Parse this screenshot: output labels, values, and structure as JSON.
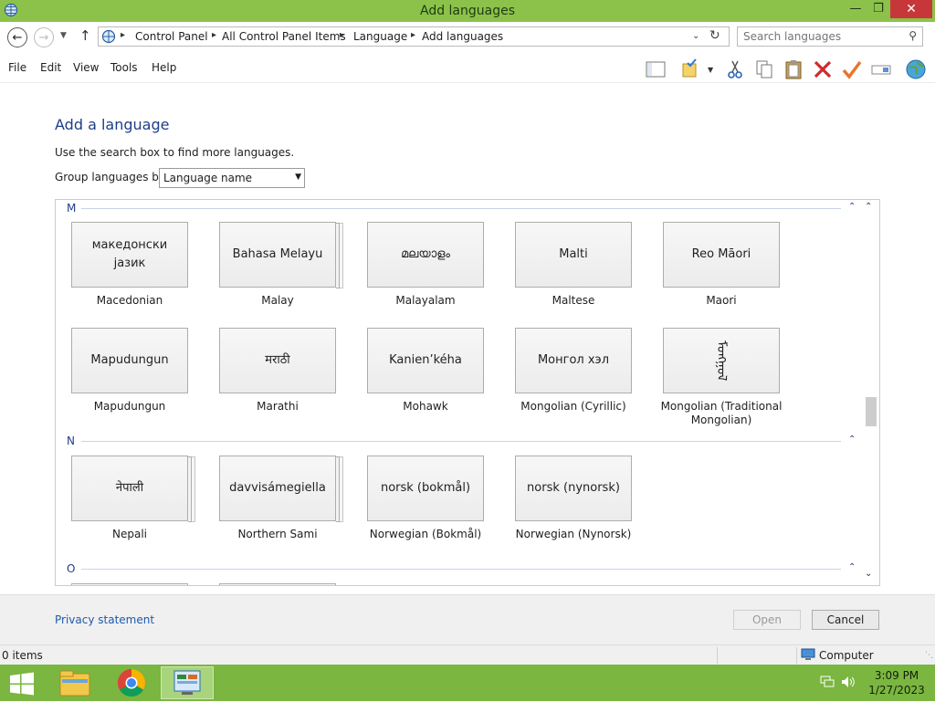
{
  "window": {
    "title": "Add languages",
    "controls": {
      "minimize": "—",
      "maximize": "❐",
      "close": "✕"
    }
  },
  "address": {
    "breadcrumbs": [
      "Control Panel",
      "All Control Panel Items",
      "Language",
      "Add languages"
    ],
    "search_placeholder": "Search languages"
  },
  "menu": {
    "items": [
      "File",
      "Edit",
      "View",
      "Tools",
      "Help"
    ]
  },
  "toolbar_icons": [
    "layout-icon",
    "properties-icon",
    "cut-icon",
    "copy-icon",
    "paste-icon",
    "delete-icon",
    "checkmark-icon",
    "rename-icon",
    "globe-icon"
  ],
  "content": {
    "heading": "Add a language",
    "hint": "Use the search box to find more languages.",
    "group_label": "Group languages by:",
    "group_value": "Language name"
  },
  "groups": [
    {
      "letter": "M",
      "languages": [
        {
          "native": "македонски јазик",
          "name": "Macedonian",
          "stacked": false
        },
        {
          "native": "Bahasa Melayu",
          "name": "Malay",
          "stacked": true
        },
        {
          "native": "മലയാളം",
          "name": "Malayalam",
          "stacked": false
        },
        {
          "native": "Malti",
          "name": "Maltese",
          "stacked": false
        },
        {
          "native": "Reo Māori",
          "name": "Maori",
          "stacked": false
        },
        {
          "native": "Mapudungun",
          "name": "Mapudungun",
          "stacked": false
        },
        {
          "native": "मराठी",
          "name": "Marathi",
          "stacked": false
        },
        {
          "native": "Kanien’kéha",
          "name": "Mohawk",
          "stacked": false
        },
        {
          "native": "Монгол хэл",
          "name": "Mongolian (Cyrillic)",
          "stacked": false
        },
        {
          "native": "ᠮᠣᠩᠭᠣᠯ",
          "name": "Mongolian (Traditional Mongolian)",
          "stacked": false
        }
      ]
    },
    {
      "letter": "N",
      "languages": [
        {
          "native": "नेपाली",
          "name": "Nepali",
          "stacked": true
        },
        {
          "native": "davvisámegiella",
          "name": "Northern Sami",
          "stacked": true
        },
        {
          "native": "norsk (bokmål)",
          "name": "Norwegian (Bokmål)",
          "stacked": false
        },
        {
          "native": "norsk (nynorsk)",
          "name": "Norwegian (Nynorsk)",
          "stacked": false
        }
      ]
    },
    {
      "letter": "O",
      "languages": []
    }
  ],
  "footer": {
    "privacy": "Privacy statement",
    "open": "Open",
    "cancel": "Cancel"
  },
  "status": {
    "items": "0 items",
    "location": "Computer"
  },
  "taskbar": {
    "time": "3:09 PM",
    "date": "1/27/2023"
  },
  "colors": {
    "titlebar": "#8cc24a",
    "taskbar": "#7ab640",
    "heading": "#1e3e8a",
    "link": "#1e5aa8",
    "close": "#c7373a"
  }
}
